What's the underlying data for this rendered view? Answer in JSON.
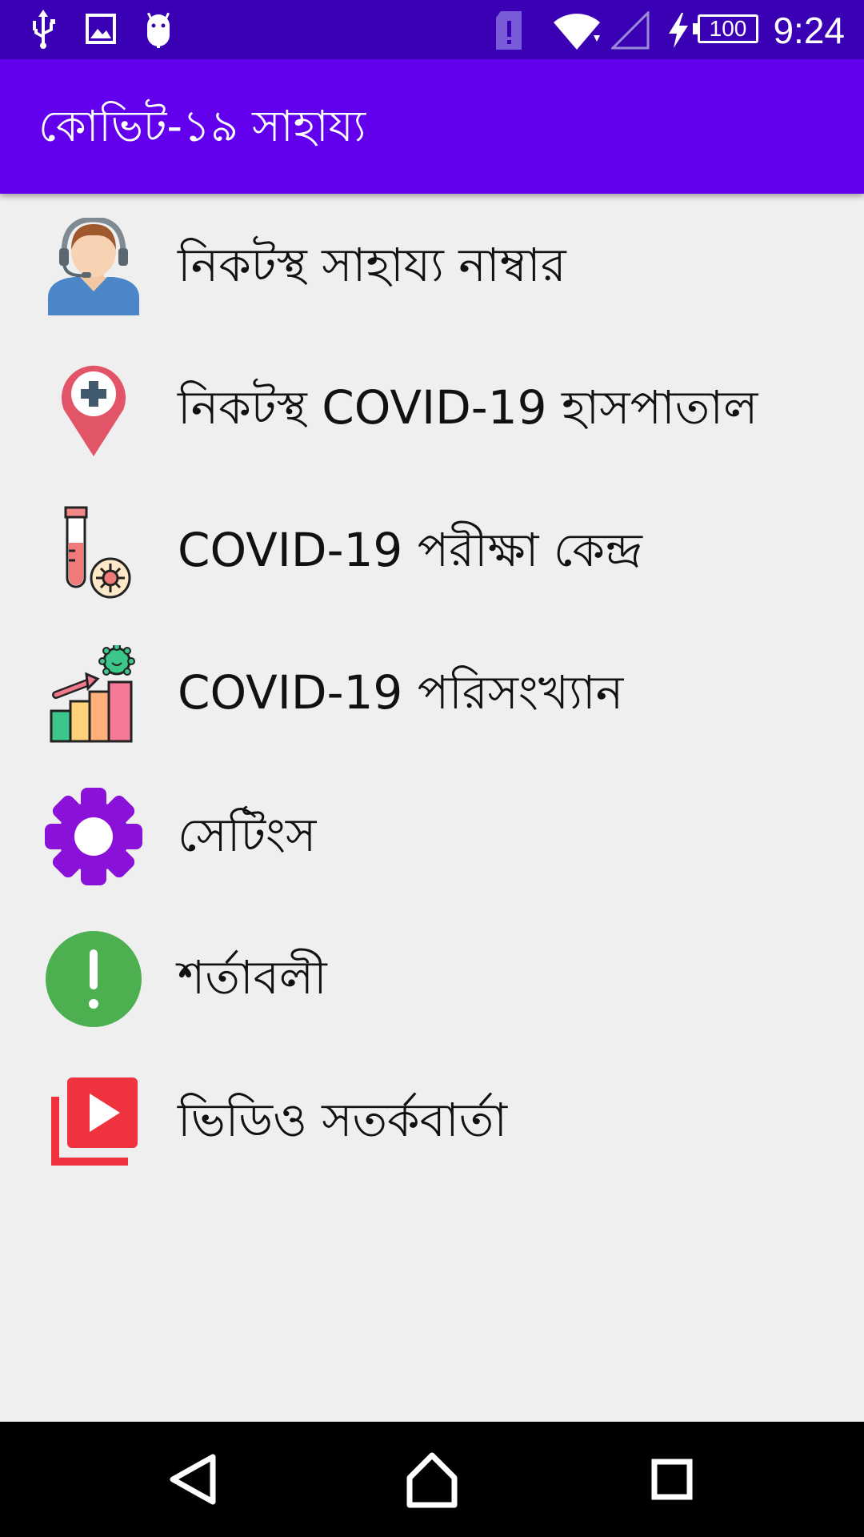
{
  "status_bar": {
    "time": "9:24",
    "battery": "100",
    "icons": [
      "usb-icon",
      "image-icon",
      "android-debug-icon",
      "sim-alert-icon",
      "wifi-icon",
      "cell-signal-icon",
      "charging-icon",
      "battery-icon"
    ]
  },
  "app_bar": {
    "title": "কোভিট-১৯ সাহায্য",
    "color": "#6200ee"
  },
  "menu": {
    "items": [
      {
        "label": "নিকটস্থ সাহায্য নাম্বার",
        "icon": "helpline-agent-icon"
      },
      {
        "label": "নিকটস্থ COVID-19 হাসপাতাল",
        "icon": "hospital-location-pin-icon"
      },
      {
        "label": "COVID-19 পরীক্ষা কেন্দ্র",
        "icon": "test-tube-virus-icon"
      },
      {
        "label": "COVID-19 পরিসংখ্যান",
        "icon": "statistics-chart-icon"
      },
      {
        "label": "সেটিংস",
        "icon": "gear-icon"
      },
      {
        "label": "শর্তাবলী",
        "icon": "exclamation-circle-icon"
      },
      {
        "label": "ভিডিও সতর্কবার্তা",
        "icon": "video-library-icon"
      }
    ]
  },
  "nav_bar": {
    "buttons": [
      "back-icon",
      "home-icon",
      "recents-icon"
    ]
  }
}
